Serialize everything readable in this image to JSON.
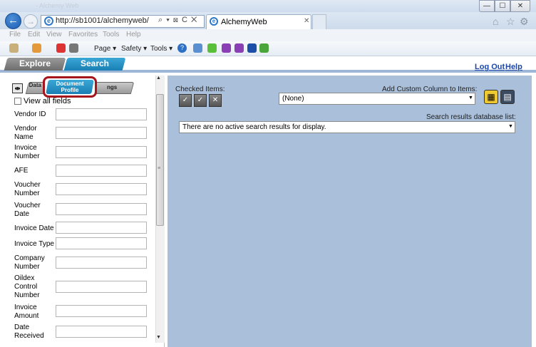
{
  "window": {
    "title": "- Alchemy Web",
    "min": "—",
    "max": "☐",
    "close": "✕"
  },
  "browser": {
    "url": "http://sb1001/alchemyweb/",
    "addr_tools": "⌕ ▾ ⊠ C ✕",
    "tab_label": "AlchemyWeb",
    "tab_close": "✕",
    "right_icons": [
      "⌂",
      "☆",
      "⚙"
    ]
  },
  "menubar": {
    "items": [
      "File",
      "Edit",
      "View",
      "Favorites",
      "Tools",
      "Help"
    ]
  },
  "commandbar": {
    "page": "Page ▾",
    "safety": "Safety ▾",
    "tools": "Tools ▾",
    "help_icon": "?"
  },
  "app": {
    "tabs": {
      "explore": "Explore",
      "search": "Search"
    },
    "logout": "Log Out",
    "help": "Help"
  },
  "left": {
    "dock_button": "⇹",
    "tab1_label": "Data Cri",
    "doc_tab_label": "Document Profile",
    "tab3_label": "ngs",
    "view_all": "View all fields",
    "fields": [
      "Vendor ID",
      "Vendor Name",
      "Invoice Number",
      "AFE",
      "Voucher Number",
      "Voucher Date",
      "Invoice Date",
      "Invoice Type",
      "Company Number",
      "Oildex Control Number",
      "Invoice Amount",
      "Date Received"
    ]
  },
  "right": {
    "checked_items": "Checked Items:",
    "check_buttons": [
      "✓",
      "✓",
      "✕"
    ],
    "custom_column_label": "Add Custom Column to Items:",
    "custom_column_value": "(None)",
    "grid_view_icon": "▦",
    "list_view_icon": "▤",
    "srdb_label": "Search results database list:",
    "srdb_value": "There are no active search results for display."
  },
  "scrollbar": {
    "up": "▲",
    "down": "▼",
    "grip": "≡"
  },
  "select_arrow": "▼",
  "colors": {
    "accent_tab": "#1a7fb4",
    "highlight": "#a6141c",
    "right_panel": "#a9bfda"
  }
}
